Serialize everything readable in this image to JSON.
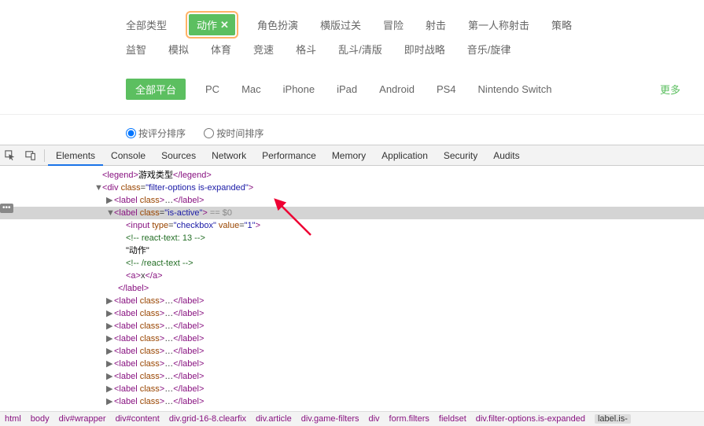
{
  "filters": {
    "type_all": "全部类型",
    "type_active": "动作",
    "types": [
      "角色扮演",
      "横版过关",
      "冒险",
      "射击",
      "第一人称射击",
      "策略",
      "益智",
      "模拟",
      "体育",
      "竞速",
      "格斗",
      "乱斗/清版",
      "即时战略",
      "音乐/旋律"
    ],
    "platform_all": "全部平台",
    "platforms": [
      "PC",
      "Mac",
      "iPhone",
      "iPad",
      "Android",
      "PS4",
      "Nintendo Switch"
    ],
    "more": "更多",
    "sort_rating": "按评分排序",
    "sort_time": "按时间排序"
  },
  "devtools": {
    "tabs": [
      "Elements",
      "Console",
      "Sources",
      "Network",
      "Performance",
      "Memory",
      "Application",
      "Security",
      "Audits"
    ],
    "dom": {
      "legend_open": "<legend>",
      "legend_text": "游戏类型",
      "legend_close": "</legend>",
      "div_open": "<div class=\"filter-options is-expanded\">",
      "label_empty": "<label class>…</label>",
      "label_active_open": "<label class=\"is-active\">",
      "sel_marker": " == $0",
      "input_line": "<input type=\"checkbox\" value=\"1\">",
      "react_open": "<!-- react-text: 13 -->",
      "text_node": "\"动作\"",
      "react_close": "<!-- /react-text -->",
      "a_line": "<a>x</a>",
      "label_close": "</label>"
    },
    "breadcrumb": [
      "html",
      "body",
      "div#wrapper",
      "div#content",
      "div.grid-16-8.clearfix",
      "div.article",
      "div.game-filters",
      "div",
      "form.filters",
      "fieldset",
      "div.filter-options.is-expanded",
      "label.is-"
    ]
  }
}
